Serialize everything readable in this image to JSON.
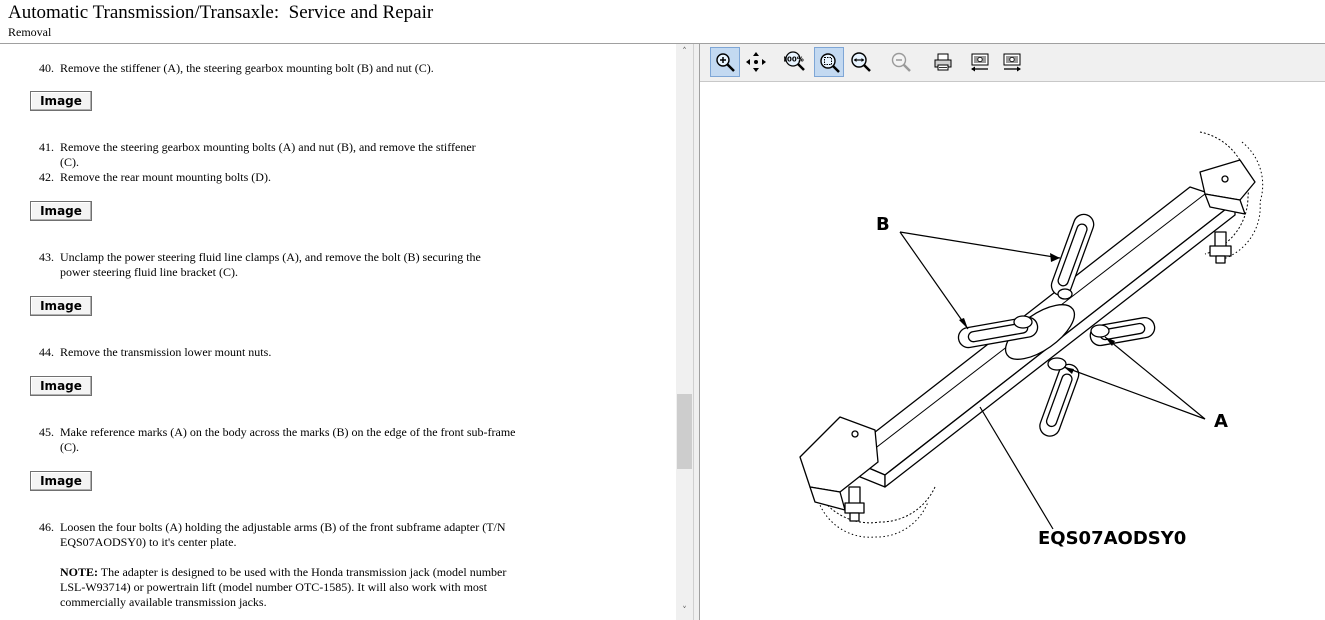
{
  "header": {
    "title": "Automatic Transmission/Transaxle:  Service and Repair",
    "subtitle": "Removal"
  },
  "steps": [
    {
      "num": "40.",
      "text": "Remove the stiffener (A), the steering gearbox mounting bolt (B) and nut (C)."
    },
    {
      "num": "41.",
      "text": "Remove the steering gearbox mounting bolts (A) and nut (B), and remove the stiffener (C)."
    },
    {
      "num": "42.",
      "text": "Remove the rear mount mounting bolts (D)."
    },
    {
      "num": "43.",
      "text": "Unclamp the power steering fluid line clamps (A), and remove the bolt (B) securing the power steering fluid line bracket (C)."
    },
    {
      "num": "44.",
      "text": "Remove the transmission lower mount nuts."
    },
    {
      "num": "45.",
      "text": "Make reference marks (A) on the body across the marks (B) on the edge of the front sub-frame (C)."
    },
    {
      "num": "46.",
      "text": "Loosen the four bolts (A) holding the adjustable arms (B) of the front subframe adapter (T/N EQS07AODSY0) to it's center plate."
    }
  ],
  "note": {
    "label": "NOTE:",
    "text": " The adapter is designed to be used with the Honda transmission jack (model number LSL-W93714) or powertrain lift (model number OTC-1585). It will also work with most commercially available transmission jacks."
  },
  "image_button_label": "Image",
  "toolbar": {
    "buttons": [
      "zoom-in-icon",
      "pan-icon",
      "zoom-100-icon",
      "zoom-fit-icon",
      "zoom-width-icon",
      "zoom-out-icon",
      "print-icon",
      "rotate-left-icon",
      "rotate-right-icon"
    ],
    "zoom_100_text": "100%"
  },
  "figure": {
    "label_b": "B",
    "label_a": "A",
    "part_number": "EQS07AODSY0"
  },
  "colors": {
    "toolbar_bg": "#f0f0f0",
    "active_button": "#c3d9f1",
    "divider": "#f0f0f0"
  }
}
